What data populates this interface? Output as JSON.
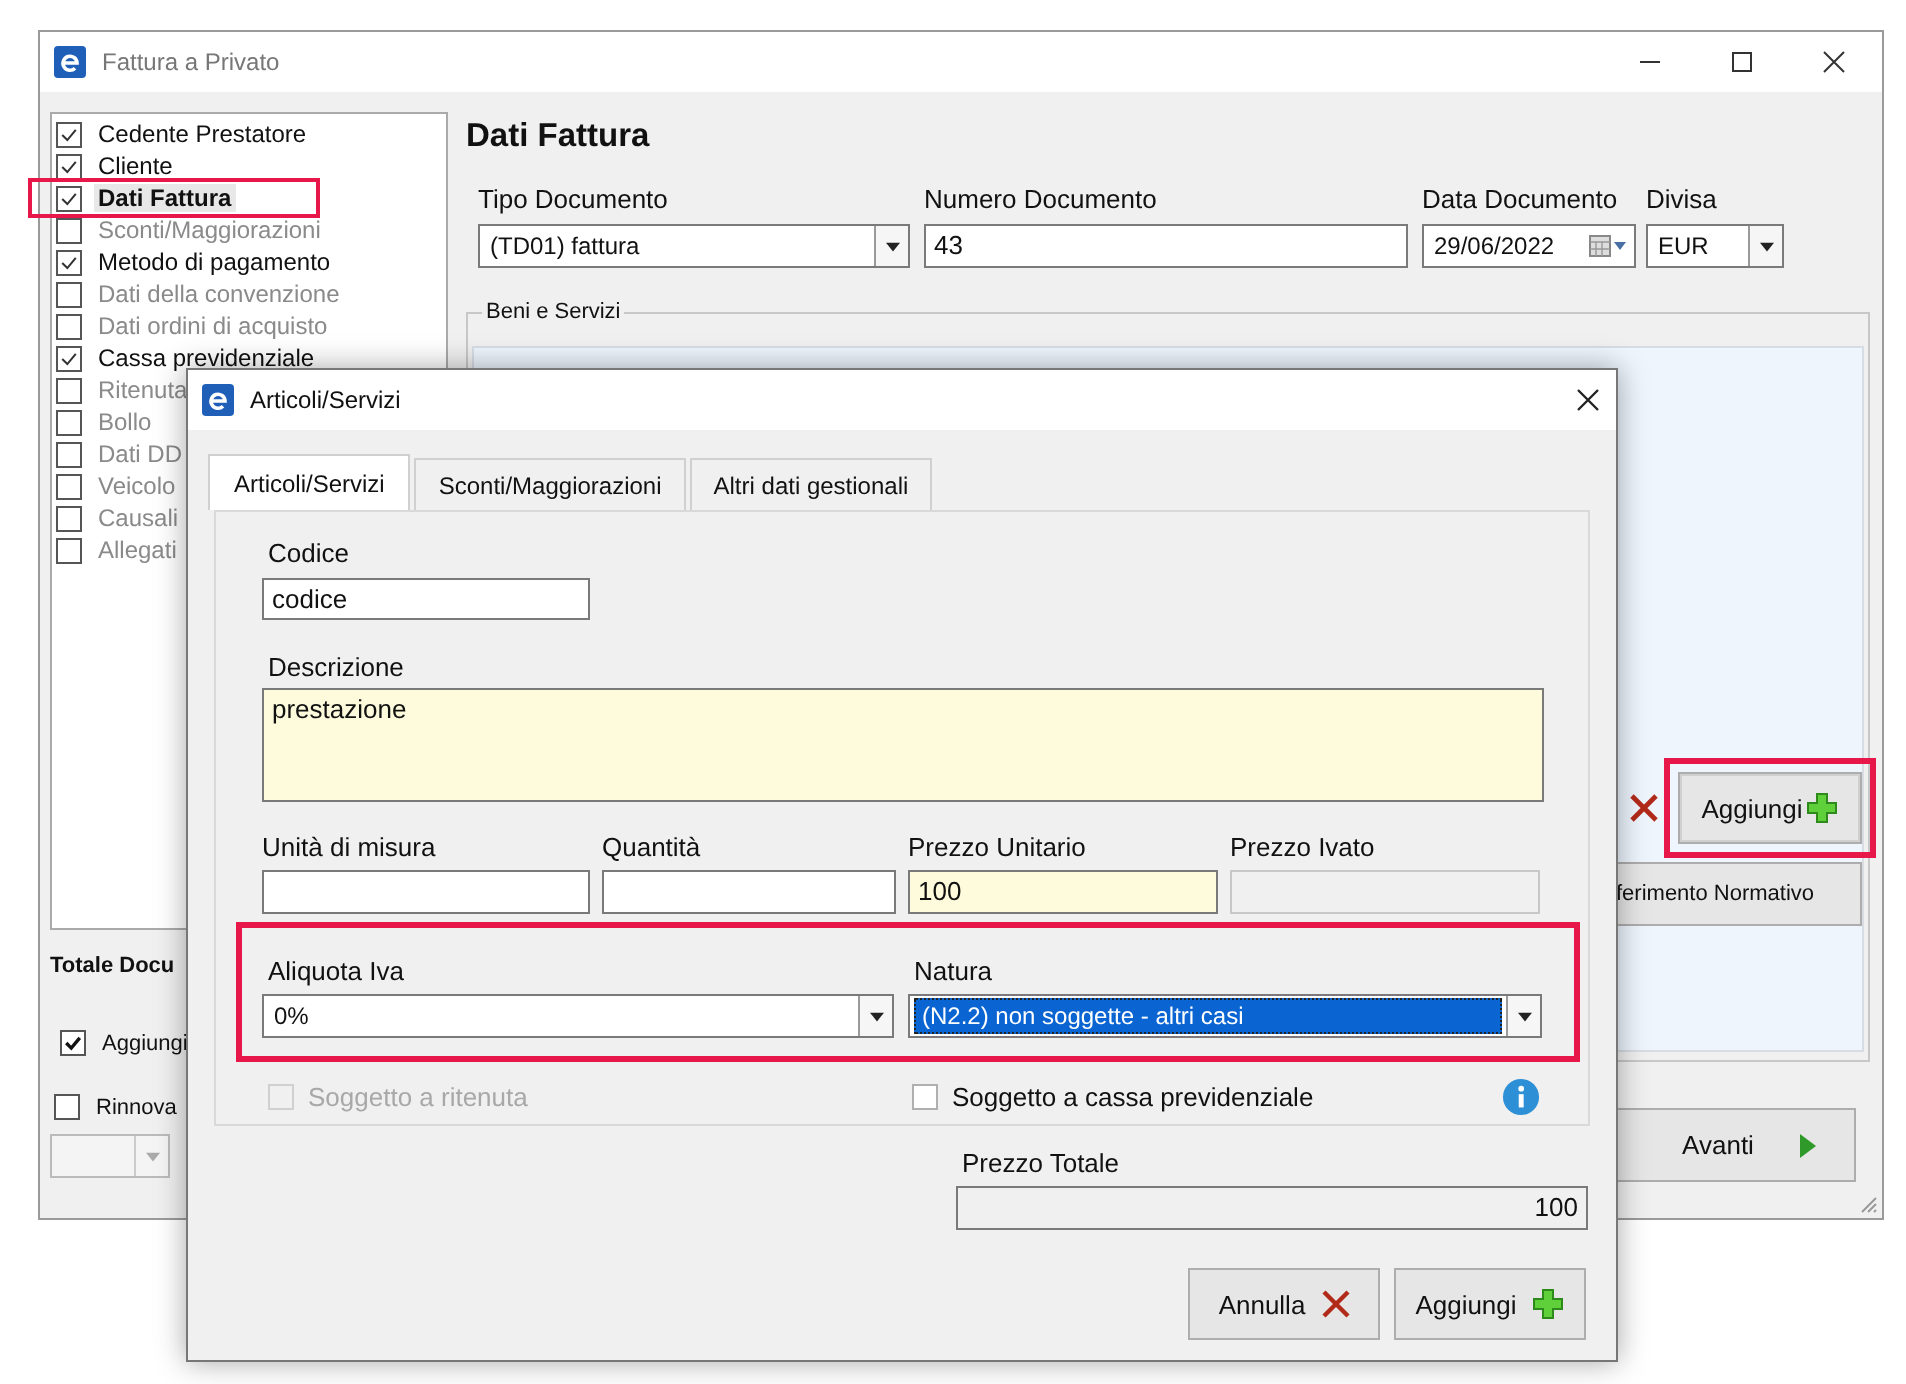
{
  "main_window": {
    "title": "Fattura a Privato",
    "sections": [
      {
        "label": "Cedente Prestatore",
        "checked": true,
        "selected": false,
        "highlighted": false
      },
      {
        "label": "Cliente",
        "checked": true,
        "selected": false,
        "highlighted": false
      },
      {
        "label": "Dati Fattura",
        "checked": true,
        "selected": true,
        "highlighted": true
      },
      {
        "label": "Sconti/Maggiorazioni",
        "checked": false,
        "selected": false,
        "highlighted": false
      },
      {
        "label": "Metodo di pagamento",
        "checked": true,
        "selected": false,
        "highlighted": false
      },
      {
        "label": "Dati della convenzione",
        "checked": false,
        "selected": false,
        "highlighted": false
      },
      {
        "label": "Dati ordini di acquisto",
        "checked": false,
        "selected": false,
        "highlighted": false
      },
      {
        "label": "Cassa previdenziale",
        "checked": true,
        "selected": false,
        "highlighted": false
      },
      {
        "label": "Ritenuta",
        "checked": false,
        "selected": false,
        "highlighted": false
      },
      {
        "label": "Bollo",
        "checked": false,
        "selected": false,
        "highlighted": false
      },
      {
        "label": "Dati DD",
        "checked": false,
        "selected": false,
        "highlighted": false
      },
      {
        "label": "Veicolo",
        "checked": false,
        "selected": false,
        "highlighted": false
      },
      {
        "label": "Causali",
        "checked": false,
        "selected": false,
        "highlighted": false
      },
      {
        "label": "Allegati",
        "checked": false,
        "selected": false,
        "highlighted": false
      }
    ],
    "heading": "Dati Fattura",
    "fields": [
      {
        "label": "Tipo Documento",
        "value": "(TD01) fattura",
        "kind": "combo"
      },
      {
        "label": "Numero Documento",
        "value": "43",
        "kind": "text"
      },
      {
        "label": "Data Documento",
        "value": "29/06/2022",
        "kind": "date"
      },
      {
        "label": "Divisa",
        "value": "EUR",
        "kind": "combo"
      }
    ],
    "group_title": "Beni e Servizi",
    "group_buttons": [
      {
        "kind": "delete"
      },
      {
        "kind": "add",
        "label": "Aggiungi",
        "highlighted": true
      },
      {
        "kind": "plain",
        "label": "ferimento Normativo"
      }
    ],
    "total_label": "Totale Docu",
    "options": [
      {
        "label": "Aggiungi",
        "checked": true
      },
      {
        "label": "Rinnova",
        "checked": false
      }
    ],
    "next_button": {
      "label": "Avanti"
    }
  },
  "dialog": {
    "title": "Articoli/Servizi",
    "tabs": [
      {
        "label": "Articoli/Servizi",
        "selected": true
      },
      {
        "label": "Sconti/Maggiorazioni",
        "selected": false
      },
      {
        "label": "Altri dati gestionali",
        "selected": false
      }
    ],
    "codice": {
      "label": "Codice",
      "value": "codice",
      "required": false
    },
    "descrizione": {
      "label": "Descrizione",
      "value": "prestazione",
      "required": true
    },
    "quantities": [
      {
        "label": "Unità di misura",
        "required": false,
        "disabled": false
      },
      {
        "label": "Quantità",
        "required": false,
        "disabled": false
      },
      {
        "label": "Prezzo Unitario",
        "value": "100",
        "required": true,
        "disabled": false
      },
      {
        "label": "Prezzo Ivato",
        "required": false,
        "disabled": true
      }
    ],
    "tax_row": {
      "highlighted": true,
      "aliquota": {
        "label": "Aliquota Iva",
        "value": "0%",
        "focused": false
      },
      "natura": {
        "label": "Natura",
        "value": "(N2.2) non soggette - altri casi",
        "focused": true
      }
    },
    "checks": [
      {
        "label": "Soggetto a ritenuta",
        "checked": false,
        "disabled": true
      },
      {
        "label": "Soggetto a cassa previdenziale",
        "checked": false,
        "disabled": false
      }
    ],
    "total": {
      "label": "Prezzo Totale",
      "value": "100"
    },
    "buttons": [
      {
        "label": "Annulla",
        "kind": "cancel"
      },
      {
        "label": "Aggiungi",
        "kind": "add"
      }
    ]
  }
}
